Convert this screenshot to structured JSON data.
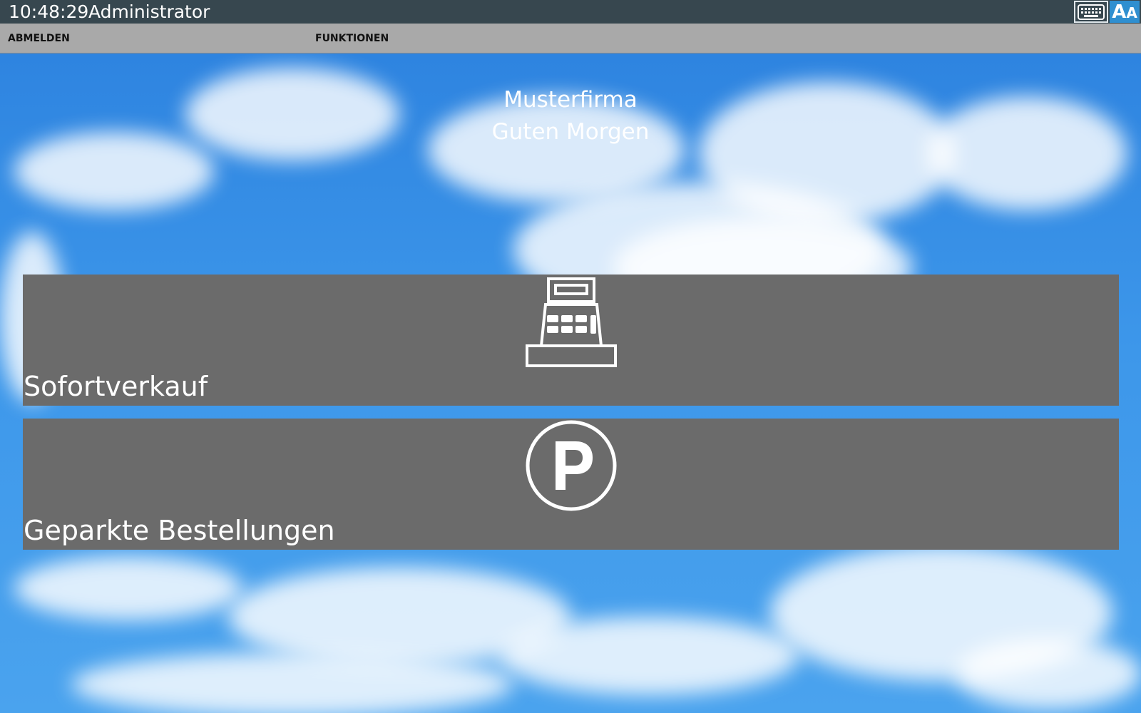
{
  "titlebar": {
    "clock": "10:48:29",
    "user": "Administrator",
    "keyboard_icon": "keyboard-icon",
    "font_size_icon": "font-size-icon",
    "font_size_label_big": "A",
    "font_size_label_small": "A"
  },
  "menubar": {
    "logout_label": "ABMELDEN",
    "functions_label": "FUNKTIONEN"
  },
  "greeting": {
    "company": "Musterfirma",
    "salutation": "Guten Morgen"
  },
  "tiles": [
    {
      "label": "Sofortverkauf",
      "icon": "cash-register-icon"
    },
    {
      "label": "Geparkte Bestellungen",
      "icon": "parking-icon"
    }
  ],
  "colors": {
    "titlebar": "#37474f",
    "menubar": "#a9a9a9",
    "tile": "#6b6b6b",
    "accent": "#2f8fd0"
  }
}
